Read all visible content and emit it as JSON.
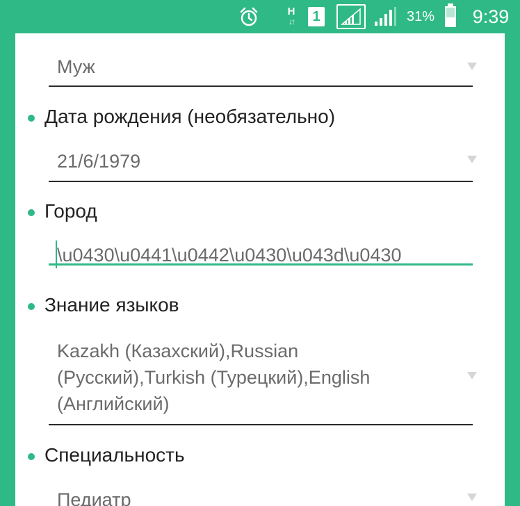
{
  "status_bar": {
    "icons": [
      "alarm-icon",
      "hspa-icon",
      "sim1-icon",
      "signal-icon",
      "signal-icon",
      "battery-icon"
    ],
    "network_type": "H",
    "sim_slot": "1",
    "battery_percent": "31%",
    "time": "9:39",
    "accent_color": "#2fb986"
  },
  "form": {
    "gender": {
      "value": "Муж"
    },
    "birth_date": {
      "label": "Дата рождения (необязательно)",
      "value": "21/6/1979"
    },
    "city": {
      "label": "Город",
      "value": "\\u0430\\u0441\\u0442\\u0430\\u043d\\u0430"
    },
    "languages": {
      "label": "Знание языков",
      "value": "Kazakh (Казахский),Russian (Русский),Turkish (Турецкий),English (Английский)"
    },
    "specialty": {
      "label": "Специальность",
      "value": "Педиатр"
    }
  }
}
